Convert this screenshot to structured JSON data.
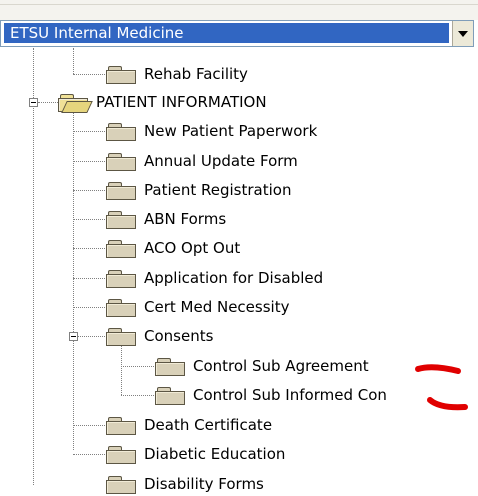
{
  "combo": {
    "selected": "ETSU Internal Medicine"
  },
  "tree": {
    "items": [
      {
        "label": "Rehab Facility"
      },
      {
        "label": "PATIENT INFORMATION"
      },
      {
        "label": "New Patient Paperwork"
      },
      {
        "label": "Annual Update Form"
      },
      {
        "label": "Patient Registration"
      },
      {
        "label": "ABN Forms"
      },
      {
        "label": "ACO Opt Out"
      },
      {
        "label": "Application for Disabled"
      },
      {
        "label": "Cert Med Necessity"
      },
      {
        "label": "Consents"
      },
      {
        "label": "Control Sub Agreement"
      },
      {
        "label": "Control Sub Informed Con"
      },
      {
        "label": "Death Certificate"
      },
      {
        "label": "Diabetic Education"
      },
      {
        "label": "Disability Forms"
      }
    ]
  },
  "annotations": {
    "color": "#e00000"
  }
}
